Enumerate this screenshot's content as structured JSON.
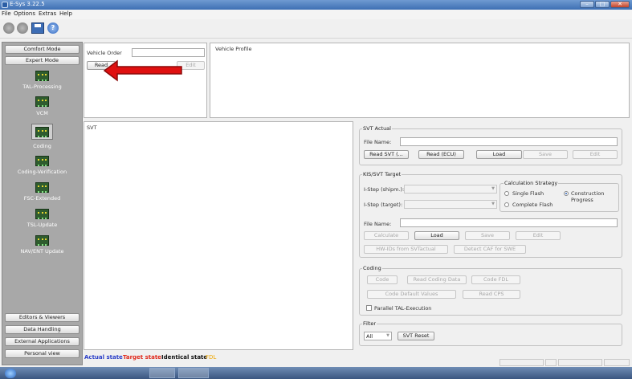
{
  "window": {
    "title": "E-Sys 3.22.5"
  },
  "menu": [
    "File",
    "Options",
    "Extras",
    "Help"
  ],
  "nav": {
    "top_buttons": [
      "Comfort Mode",
      "Expert Mode"
    ],
    "items": [
      "TAL-Processing",
      "VCM",
      "Coding",
      "Coding-Verification",
      "FSC-Extended",
      "TSL-Update",
      "NAV/ENT Update"
    ],
    "bottom_buttons": [
      "Editors & Viewers",
      "Data Handling",
      "External Applications",
      "Personal view"
    ]
  },
  "vehicle_order": {
    "label": "Vehicle Order",
    "value": "",
    "read_btn": "Read",
    "edit_btn": "Edit"
  },
  "vehicle_profile": {
    "title": "Vehicle Profile"
  },
  "svt": {
    "title": "SVT"
  },
  "svt_actual": {
    "title": "SVT Actual",
    "file_label": "File Name:",
    "buttons": [
      "Read SVT (...",
      "Read (ECU)",
      "Load",
      "Save",
      "Edit"
    ]
  },
  "kis_target": {
    "title": "KIS/SVT Target",
    "istep_shipm": "I-Step (shipm.):",
    "istep_target": "I-Step (target):",
    "calc_title": "Calculation Strategy",
    "radios": [
      "Single Flash",
      "Construction Progress",
      "Complete Flash"
    ],
    "file_label": "File Name:",
    "buttons": [
      "Calculate",
      "Load",
      "Save",
      "Edit"
    ],
    "buttons2": [
      "HW-IDs from SVTactual",
      "Detect CAF for SWE"
    ]
  },
  "coding": {
    "title": "Coding",
    "buttons": [
      "Code",
      "Read Coding Data",
      "Code FDL"
    ],
    "buttons2": [
      "Code Default Values",
      "Read CPS"
    ],
    "checkbox": "Parallel TAL-Execution"
  },
  "filter": {
    "title": "Filter",
    "select": "All",
    "reset": "SVT Reset"
  },
  "legend": {
    "actual": "Actual state",
    "target": "Target state",
    "identical": "Identical state",
    "fdl": "FDL",
    "colors": {
      "actual": "#2a3ec8",
      "target": "#e0281b",
      "identical": "#111111",
      "fdl": "#f0a800"
    }
  },
  "annotation": {
    "arrow_color": "#e01010"
  }
}
